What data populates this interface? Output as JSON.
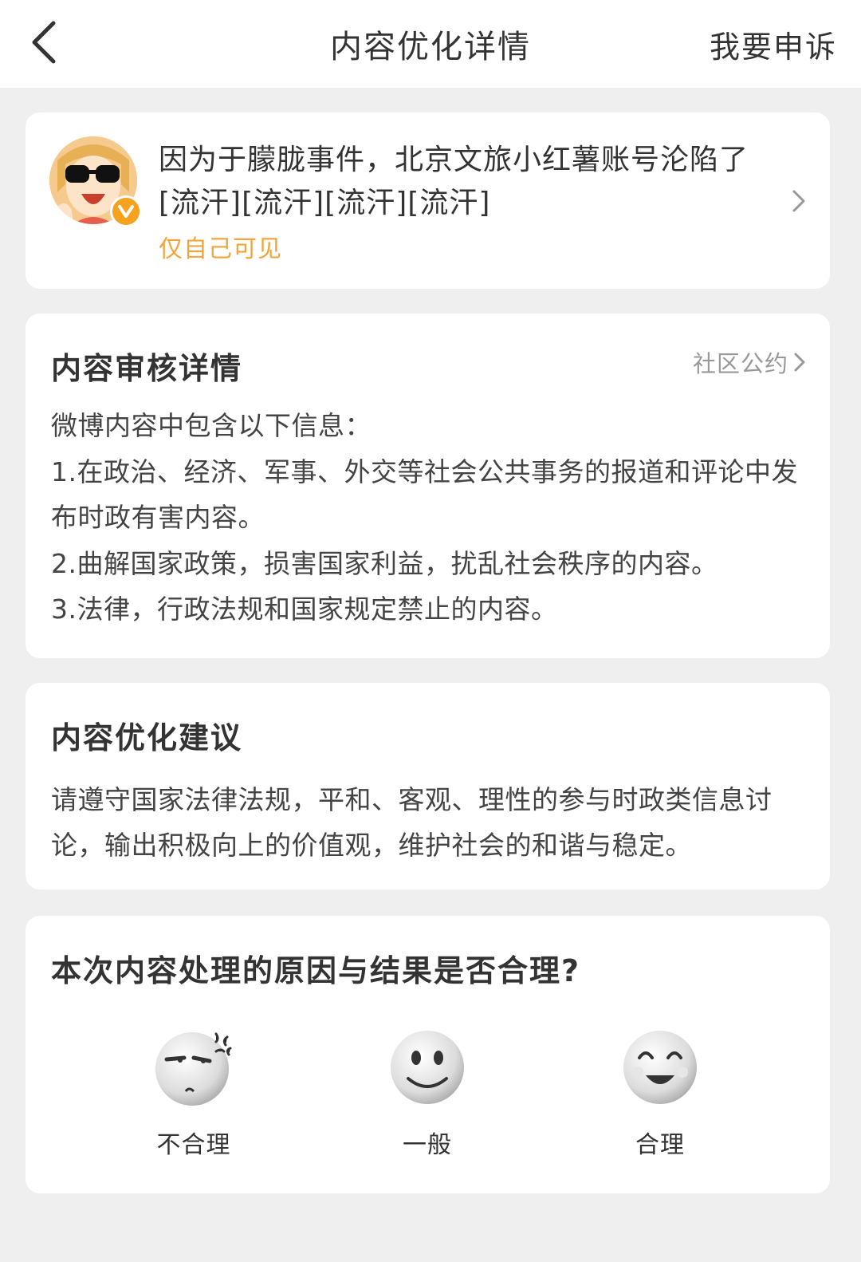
{
  "header": {
    "title": "内容优化详情",
    "appeal_label": "我要申诉"
  },
  "post": {
    "text": "因为于朦胧事件，北京文旅小红薯账号沦陷了[流汗][流汗][流汗][流汗]",
    "visibility": "仅自己可见"
  },
  "review": {
    "title": "内容审核详情",
    "rules_link": "社区公约",
    "lines": [
      "微博内容中包含以下信息：",
      "1.在政治、经济、军事、外交等社会公共事务的报道和评论中发布时政有害内容。",
      "2.曲解国家政策，损害国家利益，扰乱社会秩序的内容。",
      "3.法律，行政法规和国家规定禁止的内容。"
    ]
  },
  "advice": {
    "title": "内容优化建议",
    "text": "请遵守国家法律法规，平和、客观、理性的参与时政类信息讨论，输出积极向上的价值观，维护社会的和谐与稳定。"
  },
  "feedback": {
    "question": "本次内容处理的原因与结果是否合理?",
    "options": [
      {
        "label": "不合理",
        "icon": "angry-face-icon"
      },
      {
        "label": "一般",
        "icon": "neutral-face-icon"
      },
      {
        "label": "合理",
        "icon": "happy-face-icon"
      }
    ]
  },
  "colors": {
    "accent_orange": "#f3a53c",
    "page_bg": "#efefef",
    "card_bg": "#ffffff"
  }
}
